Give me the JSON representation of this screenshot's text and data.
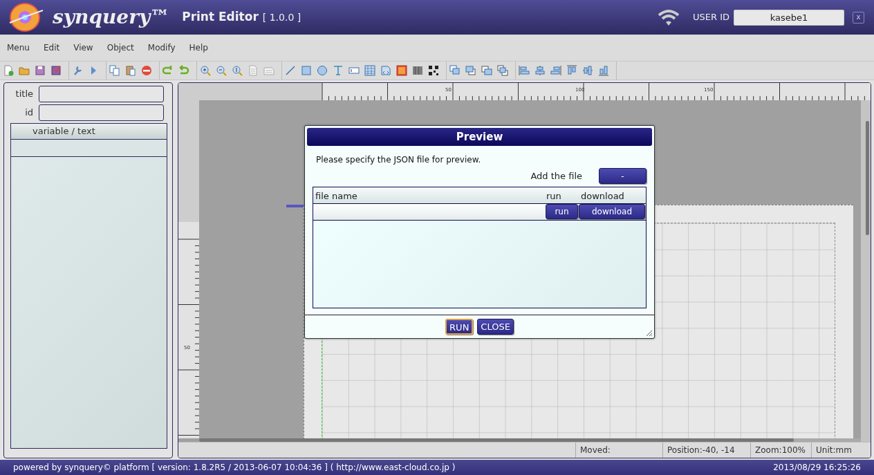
{
  "header": {
    "logo_text": "synquery™",
    "app_title": "Print Editor",
    "version": "[ 1.0.0 ]",
    "user_id_label": "USER ID",
    "user_id": "kasebe1",
    "close_label": "x"
  },
  "menu": [
    "Menu",
    "Edit",
    "View",
    "Object",
    "Modify",
    "Help"
  ],
  "properties": {
    "fields": [
      {
        "label": "title"
      },
      {
        "label": "id"
      }
    ],
    "variable_table": {
      "columns": [
        "variable / text"
      ]
    }
  },
  "canvas": {
    "top_ruler_labels": [
      "50",
      "100",
      "150"
    ],
    "left_ruler_labels": [
      "50"
    ]
  },
  "dialog": {
    "title": "Preview",
    "message": "Please specify the JSON file for preview.",
    "add_label": "Add the file",
    "add_button": "-",
    "table": {
      "columns": [
        "file name",
        "run",
        "download"
      ],
      "rows": [
        {
          "buttons": [
            "run",
            "download"
          ]
        }
      ]
    },
    "buttons": [
      {
        "label": "RUN",
        "focused": true
      },
      {
        "label": "CLOSE",
        "focused": false
      }
    ]
  },
  "status_bar": [
    "Moved:",
    "Position:-40, -14",
    "Zoom:100%",
    "Unit:mm"
  ],
  "footer": {
    "powered_by": "powered by synquery© platform [ version: 1.8.2R5 / 2013-06-07 10:04:36 ] ( http://www.east-cloud.co.jp )",
    "datetime": "2013/08/29 16:25:26"
  }
}
